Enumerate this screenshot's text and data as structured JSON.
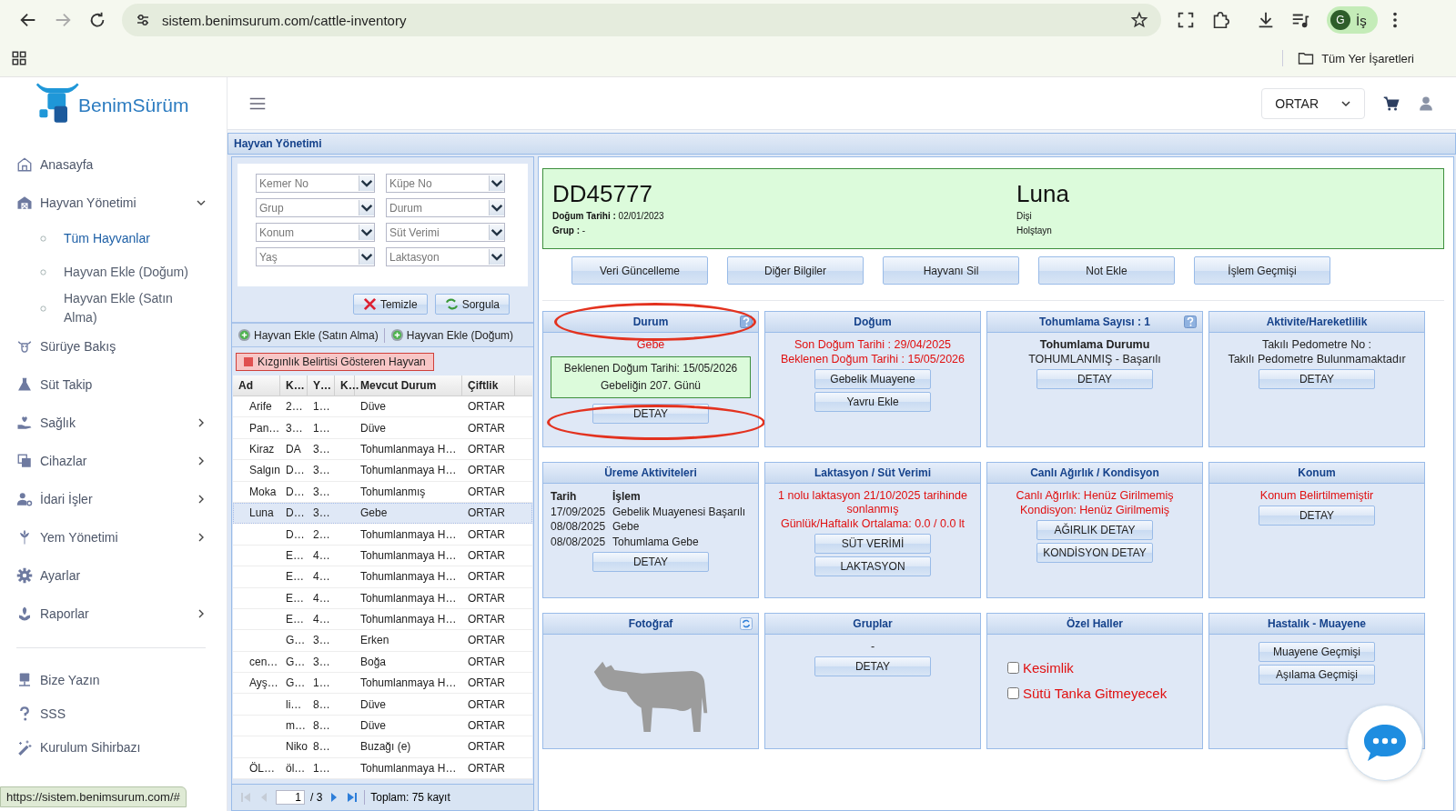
{
  "browser": {
    "url": "sistem.benimsurum.com/cattle-inventory",
    "forward_disabled": true,
    "profile_initial": "G",
    "profile_label": "İş",
    "bookmarks_folder": "Tüm Yer İşaretleri"
  },
  "sidebar": {
    "logo": "BenimSürüm",
    "items": [
      {
        "label": "Anasayfa"
      },
      {
        "label": "Hayvan Yönetimi",
        "expanded": true,
        "children": [
          {
            "label": "Tüm Hayvanlar",
            "selected": true
          },
          {
            "label": "Hayvan Ekle (Doğum)",
            "selected": false
          },
          {
            "label": "Hayvan Ekle (Satın Alma)",
            "selected": false
          }
        ]
      },
      {
        "label": "Sürüye Bakış"
      },
      {
        "label": "Süt Takip"
      },
      {
        "label": "Sağlık",
        "expanded": false
      },
      {
        "label": "Cihazlar",
        "expanded": false
      },
      {
        "label": "İdari İşler",
        "expanded": false
      },
      {
        "label": "Yem Yönetimi",
        "expanded": false
      },
      {
        "label": "Ayarlar"
      },
      {
        "label": "Raporlar",
        "expanded": false
      }
    ],
    "footer_items": [
      {
        "label": "Bize Yazın"
      },
      {
        "label": "SSS"
      },
      {
        "label": "Kurulum Sihirbazı"
      }
    ]
  },
  "topbar": {
    "farm": "ORTAR"
  },
  "panel": {
    "title": "Hayvan Yönetimi",
    "filters": [
      {
        "placeholder": "Kemer No"
      },
      {
        "placeholder": "Küpe No"
      },
      {
        "placeholder": "Grup"
      },
      {
        "placeholder": "Durum"
      },
      {
        "placeholder": "Konum"
      },
      {
        "placeholder": "Süt Verimi"
      },
      {
        "placeholder": "Yaş"
      },
      {
        "placeholder": "Laktasyon"
      }
    ],
    "clear_button": "Temizle",
    "query_button": "Sorgula",
    "add_buttons": [
      "Hayvan Ekle (Satın Alma)",
      "Hayvan Ekle (Doğum)"
    ],
    "heat_button": "Kızgınlık Belirtisi Gösteren Hayvan",
    "table": {
      "columns": [
        "Ad",
        "K…",
        "Y…",
        "K…",
        "Mevcut Durum",
        "Çiftlik"
      ],
      "rows": [
        {
          "cells": [
            "Arife",
            "2…",
            "1…",
            null,
            "Düve",
            "ORTAR"
          ],
          "selected": false
        },
        {
          "cells": [
            "Pan…",
            "3…",
            "1…",
            null,
            "Düve",
            "ORTAR"
          ],
          "selected": false
        },
        {
          "cells": [
            "Kiraz",
            "DA",
            "3…",
            null,
            "Tohumlanmaya H…",
            "ORTAR"
          ],
          "selected": false
        },
        {
          "cells": [
            "Salgın",
            "D…",
            "3…",
            null,
            "Tohumlanmaya H…",
            "ORTAR"
          ],
          "selected": false
        },
        {
          "cells": [
            "Moka",
            "D…",
            "3…",
            null,
            "Tohumlanmış",
            "ORTAR"
          ],
          "selected": false
        },
        {
          "cells": [
            "Luna",
            "D…",
            "3…",
            null,
            "Gebe",
            "ORTAR"
          ],
          "selected": true
        },
        {
          "cells": [
            null,
            "D…",
            "2…",
            null,
            "Tohumlanmaya H…",
            "ORTAR"
          ],
          "selected": false
        },
        {
          "cells": [
            null,
            "E…",
            "4…",
            null,
            "Tohumlanmaya H…",
            "ORTAR"
          ],
          "selected": false
        },
        {
          "cells": [
            null,
            "E…",
            "4…",
            null,
            "Tohumlanmaya H…",
            "ORTAR"
          ],
          "selected": false
        },
        {
          "cells": [
            null,
            "E…",
            "4…",
            null,
            "Tohumlanmaya H…",
            "ORTAR"
          ],
          "selected": false
        },
        {
          "cells": [
            null,
            "E…",
            "4…",
            null,
            "Tohumlanmaya H…",
            "ORTAR"
          ],
          "selected": false
        },
        {
          "cells": [
            null,
            "G…",
            "3…",
            null,
            "Erken",
            "ORTAR"
          ],
          "selected": false
        },
        {
          "cells": [
            "cen…",
            "G…",
            "3…",
            null,
            "Boğa",
            "ORTAR"
          ],
          "selected": false
        },
        {
          "cells": [
            "Ayş…",
            "G…",
            "1…",
            null,
            "Tohumlanmaya H…",
            "ORTAR"
          ],
          "selected": false
        },
        {
          "cells": [
            null,
            "li…",
            "8…",
            null,
            "Düve",
            "ORTAR"
          ],
          "selected": false
        },
        {
          "cells": [
            null,
            "m…",
            "8…",
            null,
            "Düve",
            "ORTAR"
          ],
          "selected": false
        },
        {
          "cells": [
            null,
            "Niko",
            "8…",
            null,
            "Buzağı (e)",
            "ORTAR"
          ],
          "selected": false
        },
        {
          "cells": [
            "ÖL…",
            "öl…",
            "1…",
            null,
            "Tohumlanmaya H…",
            "ORTAR"
          ],
          "selected": false
        }
      ]
    },
    "pager": {
      "at_first_page": true,
      "page": "1",
      "pages": "/ 3",
      "total": "Toplam: 75 kayıt"
    }
  },
  "animal": {
    "id": "DD45777",
    "name": "Luna",
    "details_left": [
      "**Doğum Tarihi :** 02/01/2023",
      "**Grup :** -"
    ],
    "details_right": [
      "Dişi",
      "Holştayn"
    ],
    "actions": [
      "Veri Güncelleme",
      "Diğer Bilgiler",
      "Hayvanı Sil",
      "Not Ekle",
      "İşlem Geçmişi"
    ],
    "cards": [
      {
        "title": "Durum",
        "help": true,
        "title_circled": true,
        "items": [
          {
            "kind": "text",
            "text": "Gebe",
            "alert": true
          },
          {
            "kind": "note",
            "lines": [
              "Beklenen Doğum Tarihi: 15/05/2026",
              "Gebeliğin 207. Günü"
            ]
          },
          {
            "kind": "button",
            "label": "DETAY",
            "circled": true
          }
        ]
      },
      {
        "title": "Doğum",
        "items": [
          {
            "kind": "text",
            "text": "Son Doğum Tarihi : 29/04/2025",
            "alert": true
          },
          {
            "kind": "text",
            "text": "Beklenen Doğum Tarihi : 15/05/2026",
            "alert": true
          },
          {
            "kind": "button",
            "label": "Gebelik Muayene"
          },
          {
            "kind": "button",
            "label": "Yavru Ekle"
          }
        ]
      },
      {
        "title": "Tohumlama Sayısı : 1",
        "help": true,
        "items": [
          {
            "kind": "text",
            "text": "Tohumlama Durumu",
            "alert": false,
            "bold": true
          },
          {
            "kind": "text",
            "text": "TOHUMLANMIŞ - Başarılı",
            "alert": false
          },
          {
            "kind": "button",
            "label": "DETAY"
          }
        ]
      },
      {
        "title": "Aktivite/Hareketlilik",
        "items": [
          {
            "kind": "text",
            "text": "Takılı Pedometre No :",
            "alert": false
          },
          {
            "kind": "text",
            "text": "Takılı Pedometre Bulunmamaktadır",
            "alert": false
          },
          {
            "kind": "button",
            "label": "DETAY"
          }
        ]
      },
      {
        "title": "Üreme Aktiviteleri",
        "items": [
          {
            "kind": "history",
            "columns": [
              "Tarih",
              "İşlem"
            ],
            "rows": [
              [
                "17/09/2025",
                "Gebelik Muayenesi Başarılı"
              ],
              [
                "08/08/2025",
                "Gebe"
              ],
              [
                "08/08/2025",
                "Tohumlama Gebe"
              ]
            ]
          },
          {
            "kind": "button",
            "label": "DETAY"
          }
        ]
      },
      {
        "title": "Laktasyon / Süt Verimi",
        "items": [
          {
            "kind": "text",
            "text": "1 nolu laktasyon 21/10/2025 tarihinde sonlanmış",
            "alert": true
          },
          {
            "kind": "text",
            "text": "Günlük/Haftalık Ortalama: 0.0 / 0.0 lt",
            "alert": true
          },
          {
            "kind": "button",
            "label": "SÜT VERİMİ"
          },
          {
            "kind": "button",
            "label": "LAKTASYON"
          }
        ]
      },
      {
        "title": "Canlı Ağırlık / Kondisyon",
        "items": [
          {
            "kind": "text",
            "text": "Canlı Ağırlık: Henüz Girilmemiş",
            "alert": true
          },
          {
            "kind": "text",
            "text": "Kondisyon: Henüz Girilmemiş",
            "alert": true
          },
          {
            "kind": "button",
            "label": "AĞIRLIK DETAY"
          },
          {
            "kind": "button",
            "label": "KONDİSYON DETAY"
          }
        ]
      },
      {
        "title": "Konum",
        "items": [
          {
            "kind": "text",
            "text": "Konum Belirtilmemiştir",
            "alert": true
          },
          {
            "kind": "button",
            "label": "DETAY"
          }
        ]
      },
      {
        "title": "Fotoğraf",
        "refresh": true,
        "items": [
          {
            "kind": "photo"
          }
        ]
      },
      {
        "title": "Gruplar",
        "items": [
          {
            "kind": "text",
            "text": "-",
            "alert": false
          },
          {
            "kind": "button",
            "label": "DETAY"
          }
        ]
      },
      {
        "title": "Özel Haller",
        "items": [
          {
            "kind": "checkbox",
            "label": "Kesimlik",
            "checked": false
          },
          {
            "kind": "checkbox",
            "label": "Sütü Tanka Gitmeyecek",
            "checked": false
          }
        ]
      },
      {
        "title": "Hastalık - Muayene",
        "items": [
          {
            "kind": "button",
            "label": "Muayene Geçmişi"
          },
          {
            "kind": "button",
            "label": "Aşılama Geçmişi"
          }
        ]
      }
    ]
  },
  "status_url": "https://sistem.benimsurum.com/#"
}
